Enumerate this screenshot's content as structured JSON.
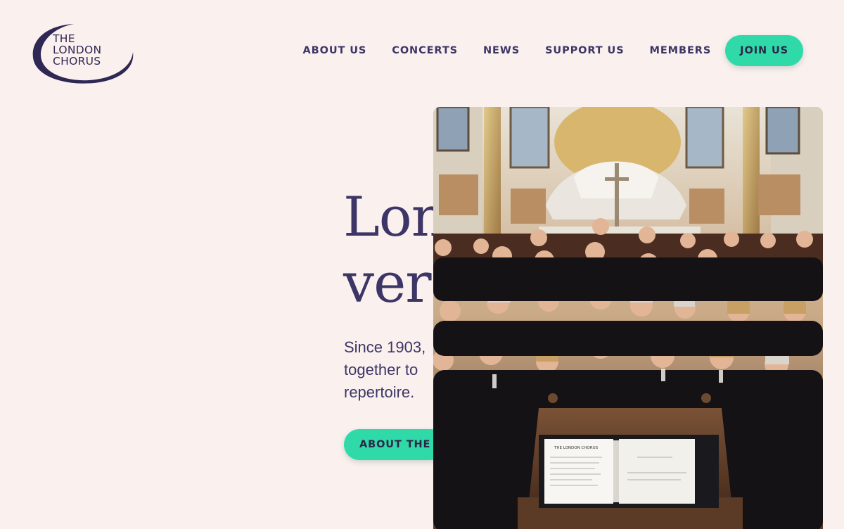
{
  "logo": {
    "lines": [
      "THE",
      "LONDON",
      "CHORUS"
    ]
  },
  "nav": {
    "items": [
      "ABOUT US",
      "CONCERTS",
      "NEWS",
      "SUPPORT US",
      "MEMBERS"
    ],
    "cta": "JOIN US"
  },
  "hero": {
    "title_visible": "Lon\nvers",
    "subtitle_visible": "Since 1903,\ntogether to\nrepertoire.",
    "button_visible": "ABOUT THE"
  },
  "photo": {
    "subject": "choir-group-photo",
    "folder_title": "THE LONDON CHORUS"
  },
  "colors": {
    "background": "#faf1ef",
    "text": "#3d3566",
    "accent": "#2fd9a8"
  }
}
